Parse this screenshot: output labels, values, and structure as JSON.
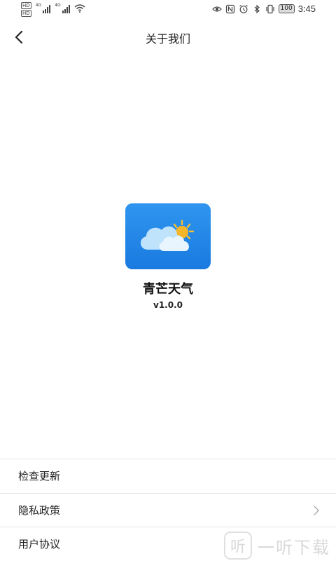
{
  "status_bar": {
    "hd_labels": [
      "HD",
      "HD"
    ],
    "network_labels": [
      "4G",
      "4G"
    ],
    "battery": "100",
    "time": "3:45"
  },
  "header": {
    "title": "关于我们",
    "back_icon": "chevron-left-icon"
  },
  "app": {
    "icon": "weather-cloud-sun-icon",
    "name": "青芒天气",
    "version": "v1.0.0",
    "icon_color": "#1f86e8"
  },
  "menu": {
    "items": [
      {
        "label": "检查更新"
      },
      {
        "label": "隐私政策"
      },
      {
        "label": "用户协议"
      }
    ]
  },
  "watermark": {
    "badge": "听",
    "text": "一听下载"
  }
}
